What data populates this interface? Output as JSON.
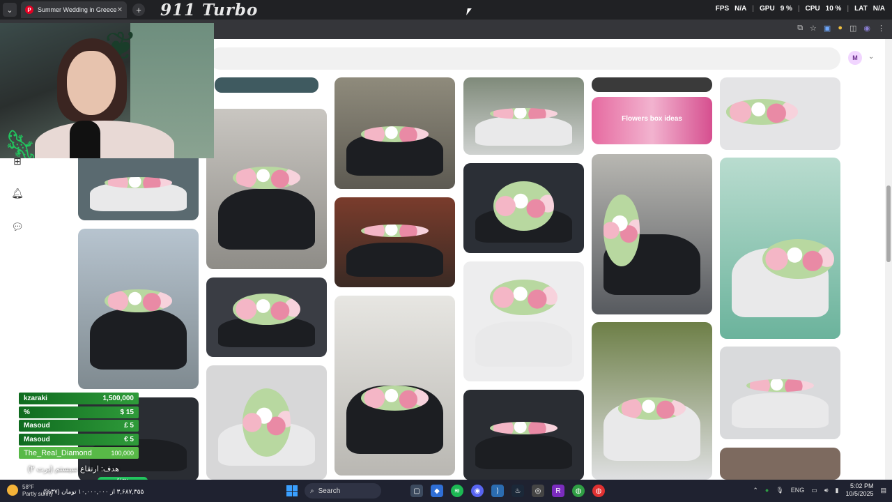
{
  "browser": {
    "tab_title": "Summer Wedding in Greece",
    "tab_favicon_letter": "P",
    "close_glyph": "✕",
    "new_tab_glyph": "+",
    "menu_glyph": "⌄"
  },
  "overlay_brand": "911 Turbo",
  "perf": {
    "fps_label": "FPS",
    "fps_value": "N/A",
    "gpu_label": "GPU",
    "gpu_value": "9 %",
    "cpu_label": "CPU",
    "cpu_value": "10 %",
    "lat_label": "LAT",
    "lat_value": "N/A"
  },
  "page": {
    "account_initial": "M",
    "pin_caption": "Flowers box ideas"
  },
  "donations": [
    {
      "name": "kzaraki",
      "amount": "1,500,000"
    },
    {
      "name": "%",
      "amount": "$ 15"
    },
    {
      "name": "Masoud",
      "amount": "£ 5"
    },
    {
      "name": "Masoud",
      "amount": "€ 5"
    },
    {
      "name": "The_Real_Diamond",
      "amount": "100,000"
    }
  ],
  "goal": {
    "text": "هدف: ارتقاع سیستم (پرت ۲)",
    "percent": "%۳۷",
    "amount_text": "۳,۶۸۷,۳۵۵ از ۱۰,۰۰۰,۰۰۰ تومان (۳۷%)"
  },
  "taskbar": {
    "weather_temp": "58°F",
    "weather_desc": "Partly sunny",
    "search_label": "Search",
    "lang": "ENG",
    "time": "5:02 PM",
    "date": "10/5/2025"
  },
  "colors": {
    "pinterest_red": "#e60023",
    "donation_green": "#2f9b3a",
    "page_bg": "#ffffff"
  },
  "icons": [
    "plus-icon",
    "bell-icon",
    "chat-icon",
    "gear-icon",
    "search-icon",
    "star-icon",
    "extensions-icon"
  ]
}
